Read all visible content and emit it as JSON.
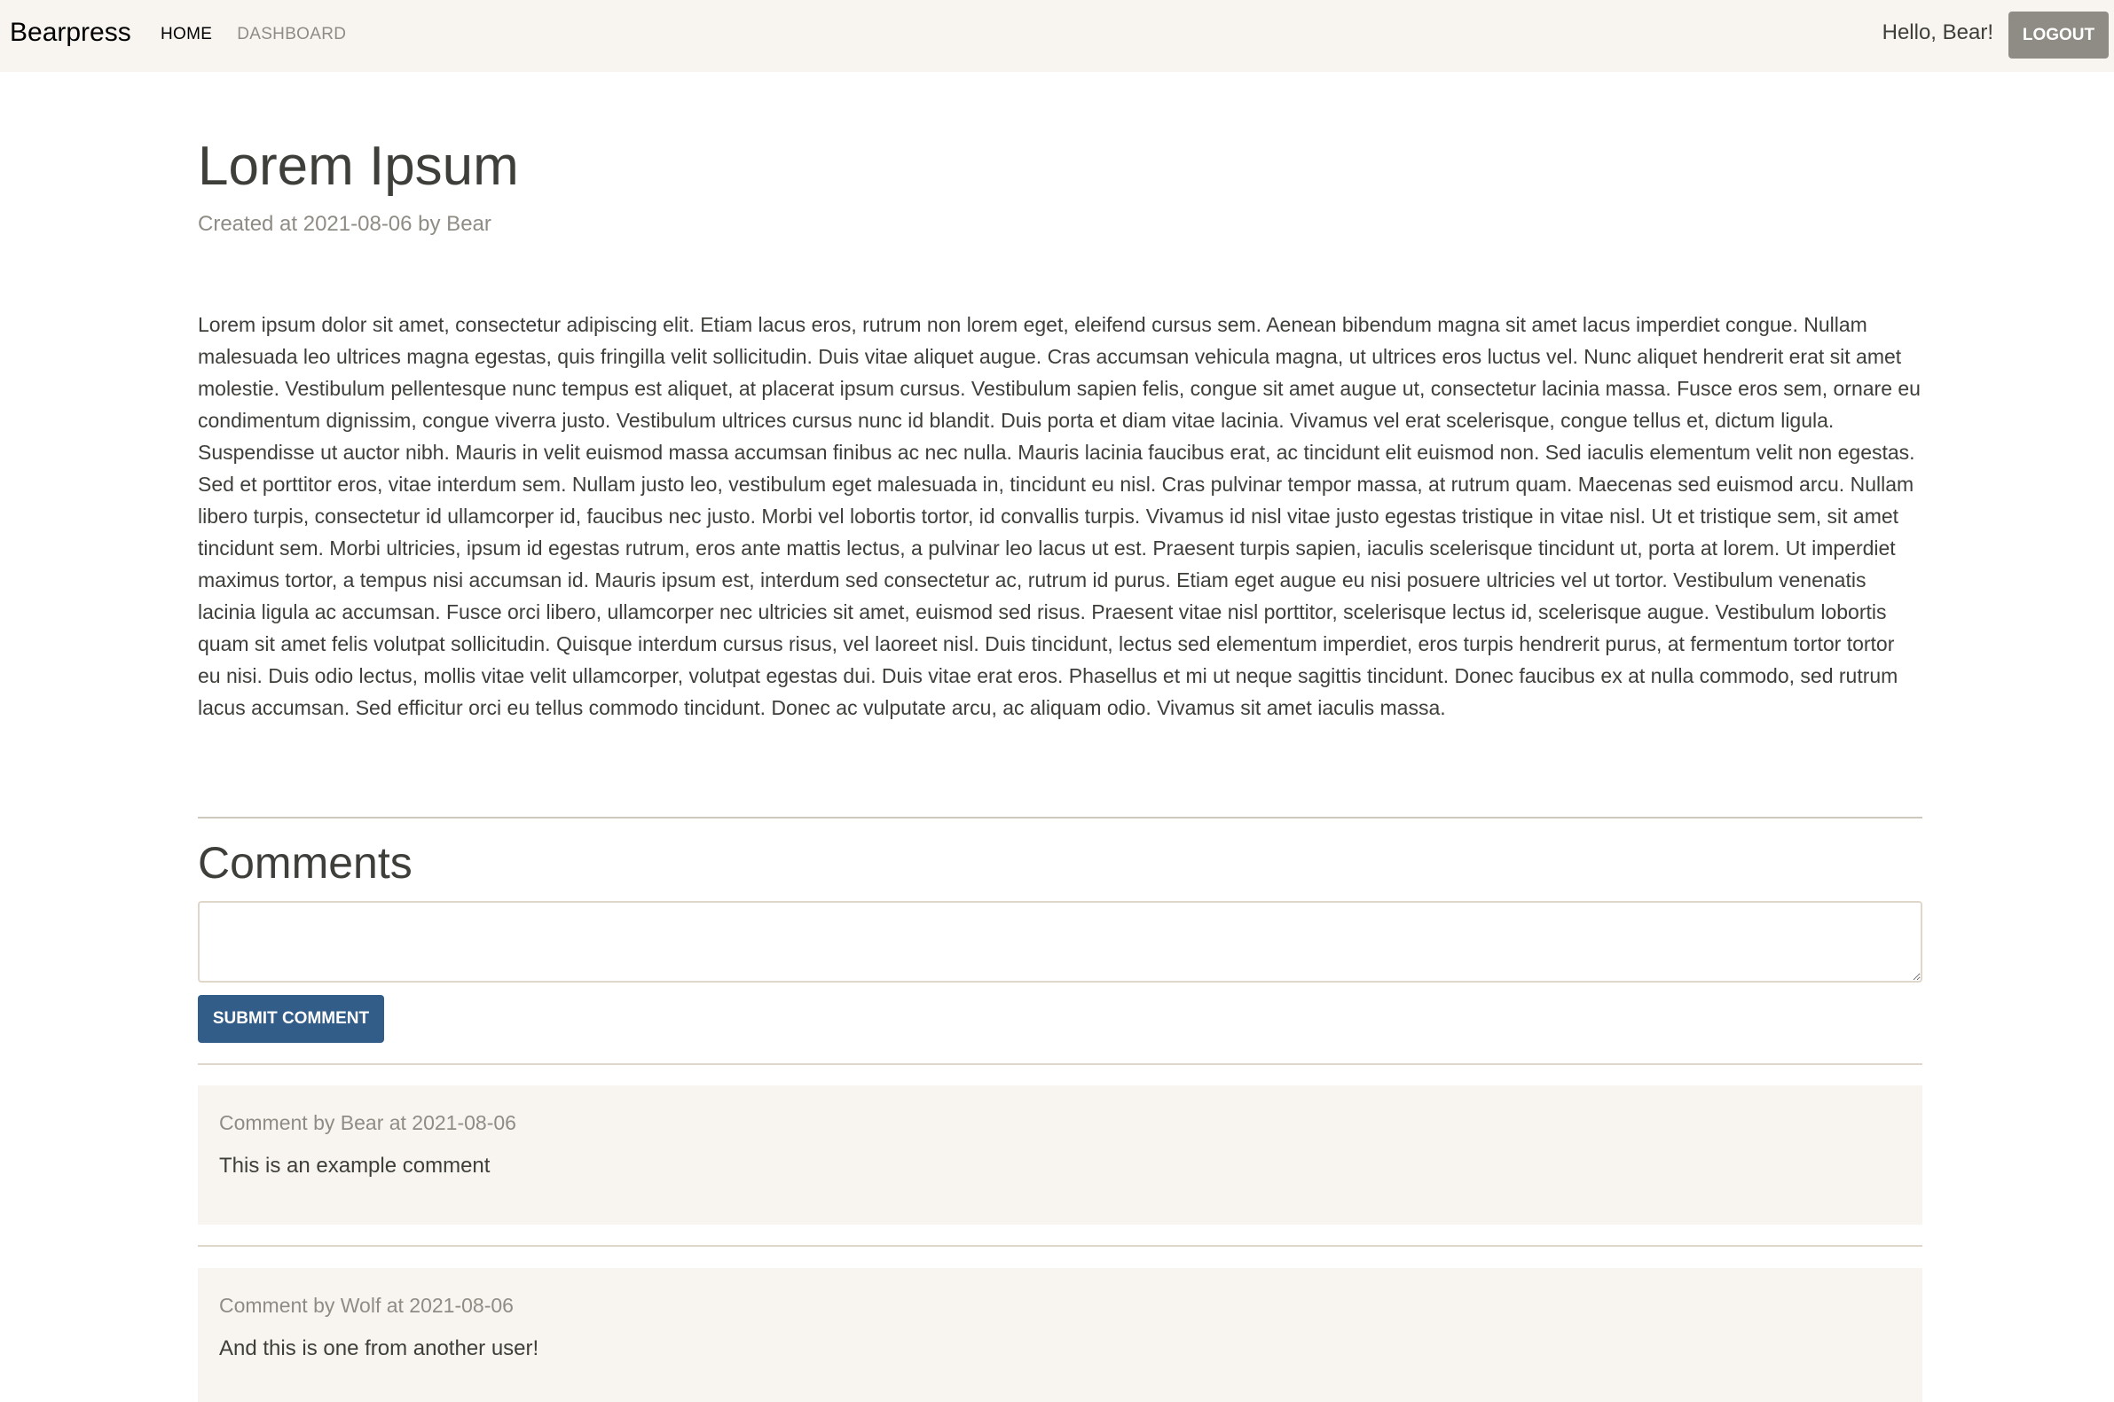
{
  "navbar": {
    "brand": "Bearpress",
    "links": [
      {
        "label": "HOME",
        "active": true
      },
      {
        "label": "DASHBOARD",
        "active": false
      }
    ],
    "greeting": "Hello, Bear!",
    "logout_label": "LOGOUT"
  },
  "post": {
    "title": "Lorem Ipsum",
    "meta": "Created at 2021-08-06 by Bear",
    "body": "Lorem ipsum dolor sit amet, consectetur adipiscing elit. Etiam lacus eros, rutrum non lorem eget, eleifend cursus sem. Aenean bibendum magna sit amet lacus imperdiet congue. Nullam malesuada leo ultrices magna egestas, quis fringilla velit sollicitudin. Duis vitae aliquet augue. Cras accumsan vehicula magna, ut ultrices eros luctus vel. Nunc aliquet hendrerit erat sit amet molestie. Vestibulum pellentesque nunc tempus est aliquet, at placerat ipsum cursus. Vestibulum sapien felis, congue sit amet augue ut, consectetur lacinia massa. Fusce eros sem, ornare eu condimentum dignissim, congue viverra justo. Vestibulum ultrices cursus nunc id blandit. Duis porta et diam vitae lacinia. Vivamus vel erat scelerisque, congue tellus et, dictum ligula. Suspendisse ut auctor nibh. Mauris in velit euismod massa accumsan finibus ac nec nulla. Mauris lacinia faucibus erat, ac tincidunt elit euismod non. Sed iaculis elementum velit non egestas. Sed et porttitor eros, vitae interdum sem. Nullam justo leo, vestibulum eget malesuada in, tincidunt eu nisl. Cras pulvinar tempor massa, at rutrum quam. Maecenas sed euismod arcu. Nullam libero turpis, consectetur id ullamcorper id, faucibus nec justo. Morbi vel lobortis tortor, id convallis turpis. Vivamus id nisl vitae justo egestas tristique in vitae nisl. Ut et tristique sem, sit amet tincidunt sem. Morbi ultricies, ipsum id egestas rutrum, eros ante mattis lectus, a pulvinar leo lacus ut est. Praesent turpis sapien, iaculis scelerisque tincidunt ut, porta at lorem. Ut imperdiet maximus tortor, a tempus nisi accumsan id. Mauris ipsum est, interdum sed consectetur ac, rutrum id purus. Etiam eget augue eu nisi posuere ultricies vel ut tortor. Vestibulum venenatis lacinia ligula ac accumsan. Fusce orci libero, ullamcorper nec ultricies sit amet, euismod sed risus. Praesent vitae nisl porttitor, scelerisque lectus id, scelerisque augue. Vestibulum lobortis quam sit amet felis volutpat sollicitudin. Quisque interdum cursus risus, vel laoreet nisl. Duis tincidunt, lectus sed elementum imperdiet, eros turpis hendrerit purus, at fermentum tortor tortor eu nisi. Duis odio lectus, mollis vitae velit ullamcorper, volutpat egestas dui. Duis vitae erat eros. Phasellus et mi ut neque sagittis tincidunt. Donec faucibus ex at nulla commodo, sed rutrum lacus accumsan. Sed efficitur orci eu tellus commodo tincidunt. Donec ac vulputate arcu, ac aliquam odio. Vivamus sit amet iaculis massa."
  },
  "comments": {
    "heading": "Comments",
    "input_value": "",
    "submit_label": "SUBMIT COMMENT",
    "items": [
      {
        "meta": "Comment by Bear at 2021-08-06",
        "text": "This is an example comment"
      },
      {
        "meta": "Comment by Wolf at 2021-08-06",
        "text": "And this is one from another user!"
      }
    ]
  },
  "colors": {
    "navbar_bg": "#f8f5f0",
    "primary": "#325d88",
    "secondary": "#8e8c84",
    "text": "#3e3f3a",
    "muted": "#8e8c84"
  }
}
